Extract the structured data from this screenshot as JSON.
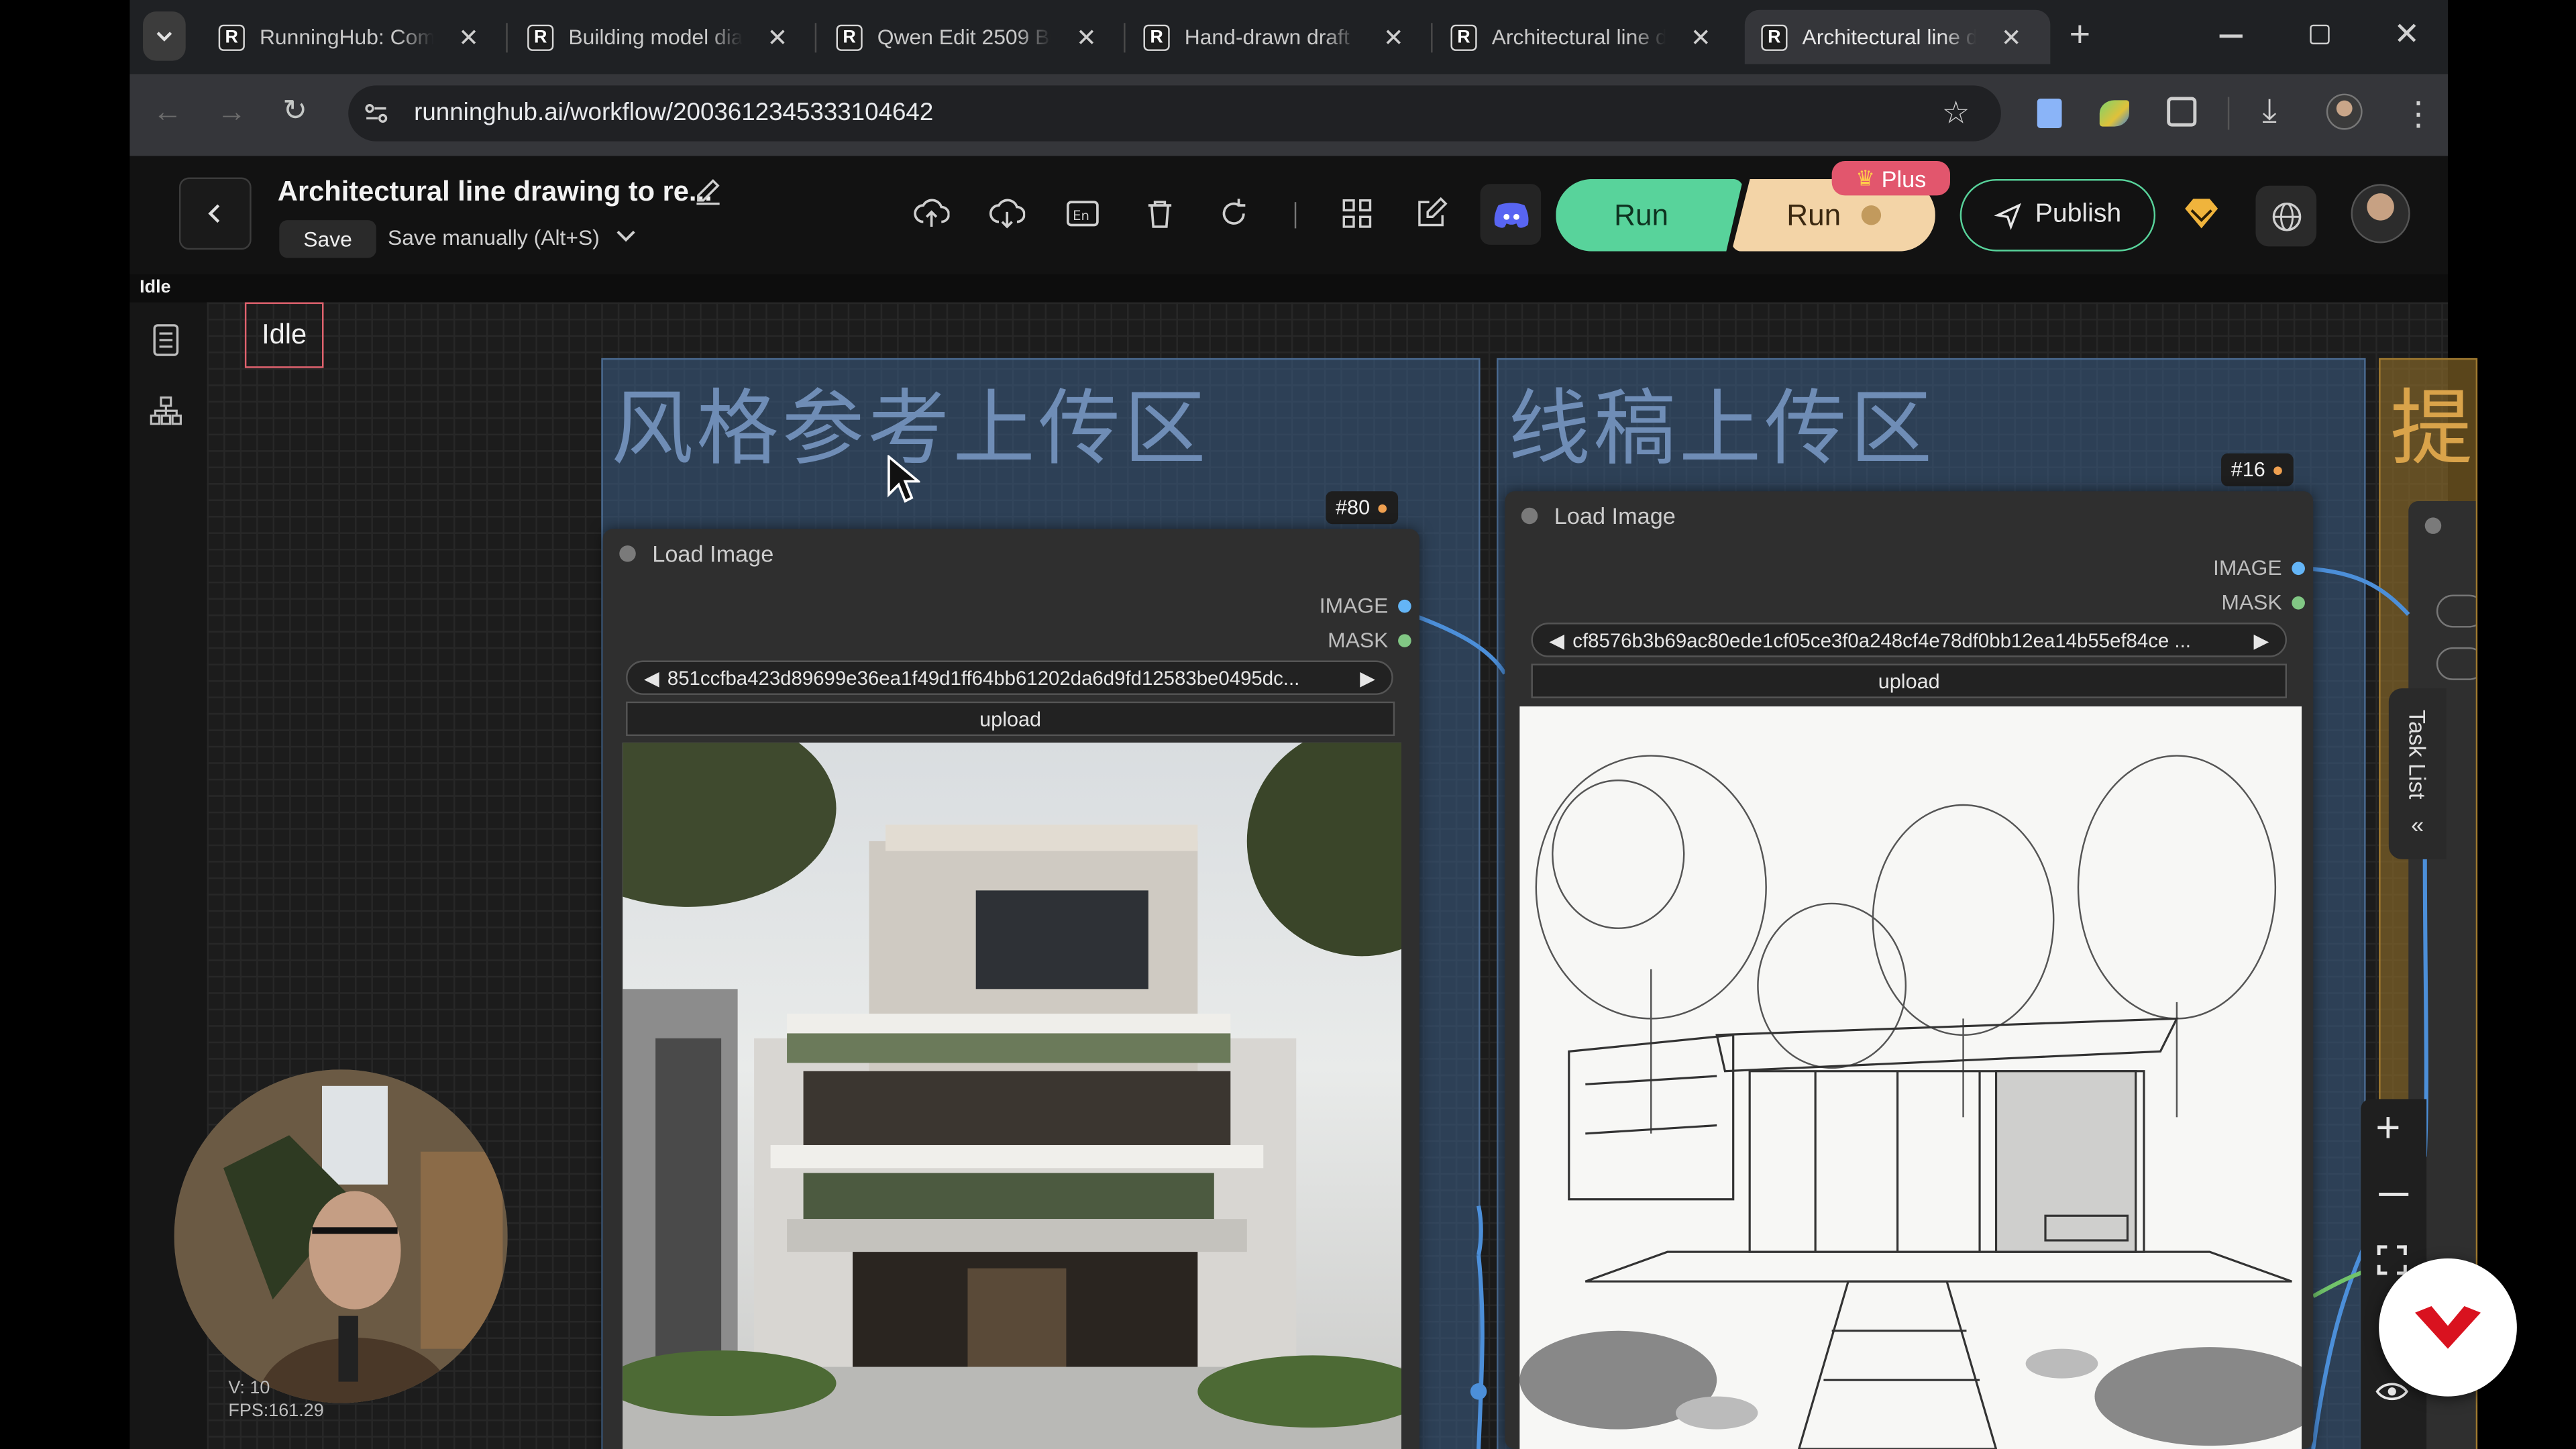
{
  "browser": {
    "tabs": [
      {
        "title": "RunningHub: Com",
        "active": false
      },
      {
        "title": "Building model dia",
        "active": false
      },
      {
        "title": "Qwen Edit 2509 Bu",
        "active": false
      },
      {
        "title": "Hand-drawn draft",
        "active": false
      },
      {
        "title": "Architectural line d",
        "active": false
      },
      {
        "title": "Architectural line d",
        "active": true
      }
    ],
    "url": "runninghub.ai/workflow/2003612345333104642",
    "favicon_letter": "R"
  },
  "header": {
    "title": "Architectural line drawing to re...",
    "save_label": "Save",
    "save_mode_label": "Save manually (Alt+S)",
    "run_label": "Run",
    "run_plus_label": "Run",
    "plus_badge": "Plus",
    "publish_label": "Publish"
  },
  "status": {
    "strip_text": "Idle",
    "badge_text": "Idle"
  },
  "groups": [
    {
      "title": "风格参考上传区",
      "color": "#3d5e86"
    },
    {
      "title": "线稿上传区",
      "color": "#3d5e86"
    },
    {
      "title": "提",
      "color": "#8a6a2a"
    }
  ],
  "nodes": [
    {
      "id_label": "#80",
      "title": "Load Image",
      "outputs": [
        "IMAGE",
        "MASK"
      ],
      "filename": "851ccfba423d89699e36ea1f49d1ff64bb61202da6d9fd12583be0495dc...",
      "upload_label": "upload"
    },
    {
      "id_label": "#16",
      "title": "Load Image",
      "outputs": [
        "IMAGE",
        "MASK"
      ],
      "filename": "cf8576b3b69ac80ede1cf05ce3f0a248cf4e78df0bb12ea14b55ef84ce ...",
      "upload_label": "upload"
    }
  ],
  "sidebar": {
    "task_list_label": "Task List"
  },
  "overlay": {
    "fps_text": "FPS:161.29",
    "v_text": "V: 10"
  },
  "colors": {
    "run": "#58d39b",
    "run_plus": "#f3d4a7",
    "plus_badge": "#e2566d",
    "image_socket": "#64b5f6",
    "mask_socket": "#81c784",
    "link": "#4c8fd9"
  }
}
